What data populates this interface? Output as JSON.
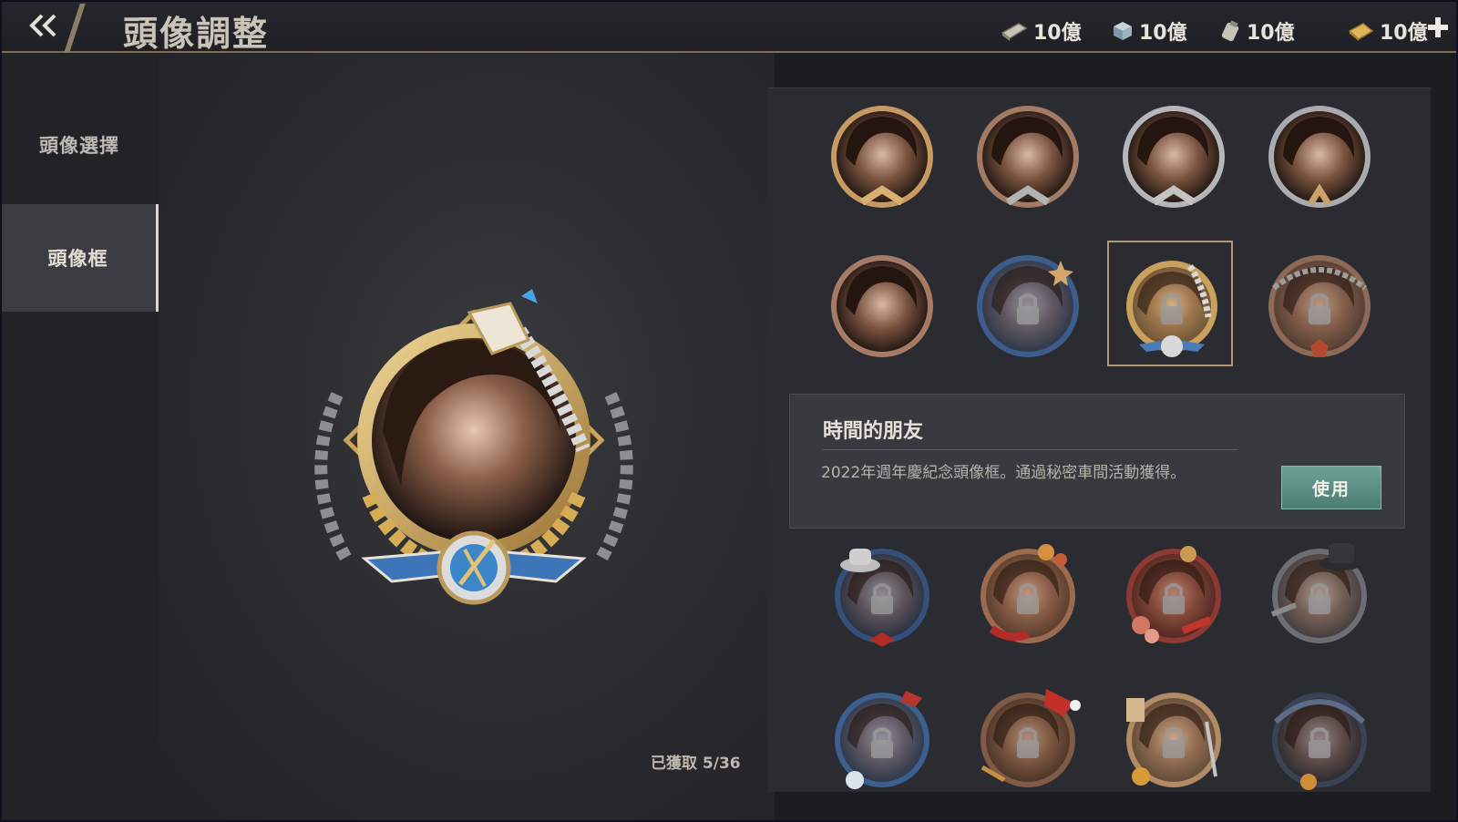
{
  "header": {
    "title": "頭像調整",
    "currencies": [
      {
        "icon": "cash-stack-icon",
        "value": "10億"
      },
      {
        "icon": "cube-icon",
        "value": "10億"
      },
      {
        "icon": "can-icon",
        "value": "10億"
      },
      {
        "icon": "gold-ticket-icon",
        "value": "10億"
      }
    ]
  },
  "sidebar": {
    "items": [
      {
        "label": "頭像選擇",
        "active": false
      },
      {
        "label": "頭像框",
        "active": true
      }
    ]
  },
  "preview": {
    "obtained": "已獲取 5/36"
  },
  "info": {
    "title": "時間的朋友",
    "description": "2022年週年慶紀念頭像框。通過秘密車間活動獲得。",
    "use_label": "使用"
  },
  "frames": [
    {
      "style": "gold-laurel",
      "locked": false
    },
    {
      "style": "bronze-laurel",
      "locked": false
    },
    {
      "style": "silver-laurel",
      "locked": false
    },
    {
      "style": "silver-plain",
      "locked": false
    },
    {
      "style": "bronze-plain",
      "locked": false
    },
    {
      "style": "blue-ribbon",
      "locked": true
    },
    {
      "style": "anniversary-gold",
      "locked": true,
      "selected": true
    },
    {
      "style": "rope-bronze",
      "locked": true
    },
    {
      "style": "blue-hat",
      "locked": true
    },
    {
      "style": "red-flowers",
      "locked": true
    },
    {
      "style": "red-roses",
      "locked": true
    },
    {
      "style": "dark-hat",
      "locked": true
    },
    {
      "style": "winter-blue",
      "locked": true
    },
    {
      "style": "christmas",
      "locked": true
    },
    {
      "style": "dinner-gold",
      "locked": true
    },
    {
      "style": "dark-steel",
      "locked": true
    }
  ],
  "colors": {
    "accent_gold": "#b49a74",
    "use_button": "#5a8d83"
  }
}
